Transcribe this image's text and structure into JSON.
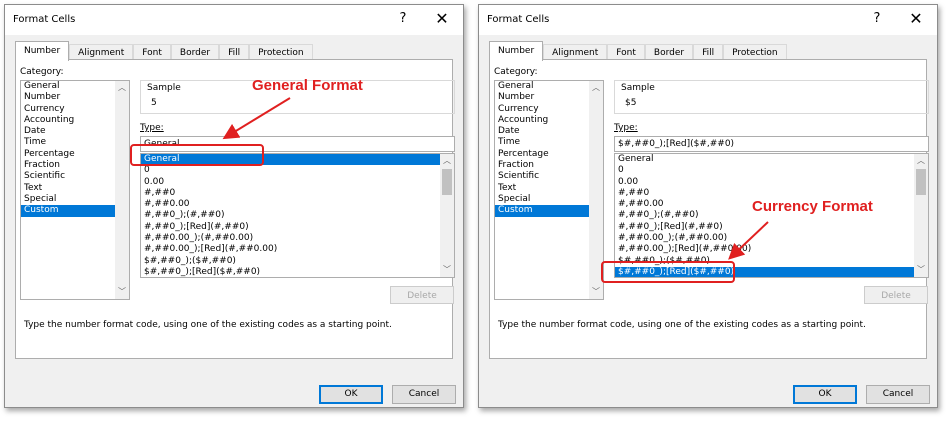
{
  "dialogs": [
    {
      "title": "Format Cells",
      "help": "?",
      "close": "✕",
      "tabs": [
        "Number",
        "Alignment",
        "Font",
        "Border",
        "Fill",
        "Protection"
      ],
      "category_label": "Category:",
      "categories": [
        "General",
        "Number",
        "Currency",
        "Accounting",
        "Date",
        "Time",
        "Percentage",
        "Fraction",
        "Scientific",
        "Text",
        "Special",
        "Custom"
      ],
      "selected_category": "Custom",
      "sample_caption": "Sample",
      "sample_value": "5",
      "type_label": "Type:",
      "type_value": "General",
      "format_list": [
        "General",
        "0",
        "0.00",
        "#,##0",
        "#,##0.00",
        "#,##0_);(#,##0)",
        "#,##0_);[Red](#,##0)",
        "#,##0.00_);(#,##0.00)",
        "#,##0.00_);[Red](#,##0.00)",
        "$#,##0_);($#,##0)",
        "$#,##0_);[Red]($#,##0)"
      ],
      "selected_format": "General",
      "delete_label": "Delete",
      "hint": "Type the number format code, using one of the existing codes as a starting point.",
      "ok": "OK",
      "cancel": "Cancel",
      "annotation": "General Format"
    },
    {
      "title": "Format Cells",
      "help": "?",
      "close": "✕",
      "tabs": [
        "Number",
        "Alignment",
        "Font",
        "Border",
        "Fill",
        "Protection"
      ],
      "category_label": "Category:",
      "categories": [
        "General",
        "Number",
        "Currency",
        "Accounting",
        "Date",
        "Time",
        "Percentage",
        "Fraction",
        "Scientific",
        "Text",
        "Special",
        "Custom"
      ],
      "selected_category": "Custom",
      "sample_caption": "Sample",
      "sample_value": "$5",
      "type_label": "Type:",
      "type_value": "$#,##0_);[Red]($#,##0)",
      "format_list": [
        "General",
        "0",
        "0.00",
        "#,##0",
        "#,##0.00",
        "#,##0_);(#,##0)",
        "#,##0_);[Red](#,##0)",
        "#,##0.00_);(#,##0.00)",
        "#,##0.00_);[Red](#,##0.00)",
        "$#,##0_);($#,##0)",
        "$#,##0_);[Red]($#,##0)"
      ],
      "selected_format": "$#,##0_);[Red]($#,##0)",
      "delete_label": "Delete",
      "hint": "Type the number format code, using one of the existing codes as a starting point.",
      "ok": "OK",
      "cancel": "Cancel",
      "annotation": "Currency Format"
    }
  ],
  "colors": {
    "selection": "#0078d7",
    "annotation": "#e02020"
  }
}
